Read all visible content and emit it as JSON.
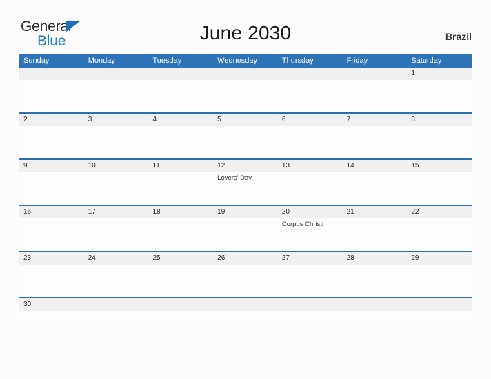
{
  "brand": {
    "name_part1": "General",
    "name_part2": "Blue",
    "triangle_icon": "triangle-icon"
  },
  "header": {
    "title": "June 2030",
    "locale": "Brazil"
  },
  "colors": {
    "header_blue": "#2e73b8",
    "rule_blue": "#2c6fb0",
    "band_gray": "#f0f0f0",
    "page_bg": "#fcfcfc",
    "logo_blue": "#1f7ac4"
  },
  "calendar": {
    "month": "June",
    "year": "2030",
    "weekdays": [
      "Sunday",
      "Monday",
      "Tuesday",
      "Wednesday",
      "Thursday",
      "Friday",
      "Saturday"
    ],
    "weeks": [
      {
        "days": [
          {
            "num": "",
            "event": ""
          },
          {
            "num": "",
            "event": ""
          },
          {
            "num": "",
            "event": ""
          },
          {
            "num": "",
            "event": ""
          },
          {
            "num": "",
            "event": ""
          },
          {
            "num": "",
            "event": ""
          },
          {
            "num": "1",
            "event": ""
          }
        ]
      },
      {
        "days": [
          {
            "num": "2",
            "event": ""
          },
          {
            "num": "3",
            "event": ""
          },
          {
            "num": "4",
            "event": ""
          },
          {
            "num": "5",
            "event": ""
          },
          {
            "num": "6",
            "event": ""
          },
          {
            "num": "7",
            "event": ""
          },
          {
            "num": "8",
            "event": ""
          }
        ]
      },
      {
        "days": [
          {
            "num": "9",
            "event": ""
          },
          {
            "num": "10",
            "event": ""
          },
          {
            "num": "11",
            "event": ""
          },
          {
            "num": "12",
            "event": "Lovers' Day"
          },
          {
            "num": "13",
            "event": ""
          },
          {
            "num": "14",
            "event": ""
          },
          {
            "num": "15",
            "event": ""
          }
        ]
      },
      {
        "days": [
          {
            "num": "16",
            "event": ""
          },
          {
            "num": "17",
            "event": ""
          },
          {
            "num": "18",
            "event": ""
          },
          {
            "num": "19",
            "event": ""
          },
          {
            "num": "20",
            "event": "Corpus Christi"
          },
          {
            "num": "21",
            "event": ""
          },
          {
            "num": "22",
            "event": ""
          }
        ]
      },
      {
        "days": [
          {
            "num": "23",
            "event": ""
          },
          {
            "num": "24",
            "event": ""
          },
          {
            "num": "25",
            "event": ""
          },
          {
            "num": "26",
            "event": ""
          },
          {
            "num": "27",
            "event": ""
          },
          {
            "num": "28",
            "event": ""
          },
          {
            "num": "29",
            "event": ""
          }
        ]
      },
      {
        "days": [
          {
            "num": "30",
            "event": ""
          },
          {
            "num": "",
            "event": ""
          },
          {
            "num": "",
            "event": ""
          },
          {
            "num": "",
            "event": ""
          },
          {
            "num": "",
            "event": ""
          },
          {
            "num": "",
            "event": ""
          },
          {
            "num": "",
            "event": ""
          }
        ]
      }
    ]
  }
}
